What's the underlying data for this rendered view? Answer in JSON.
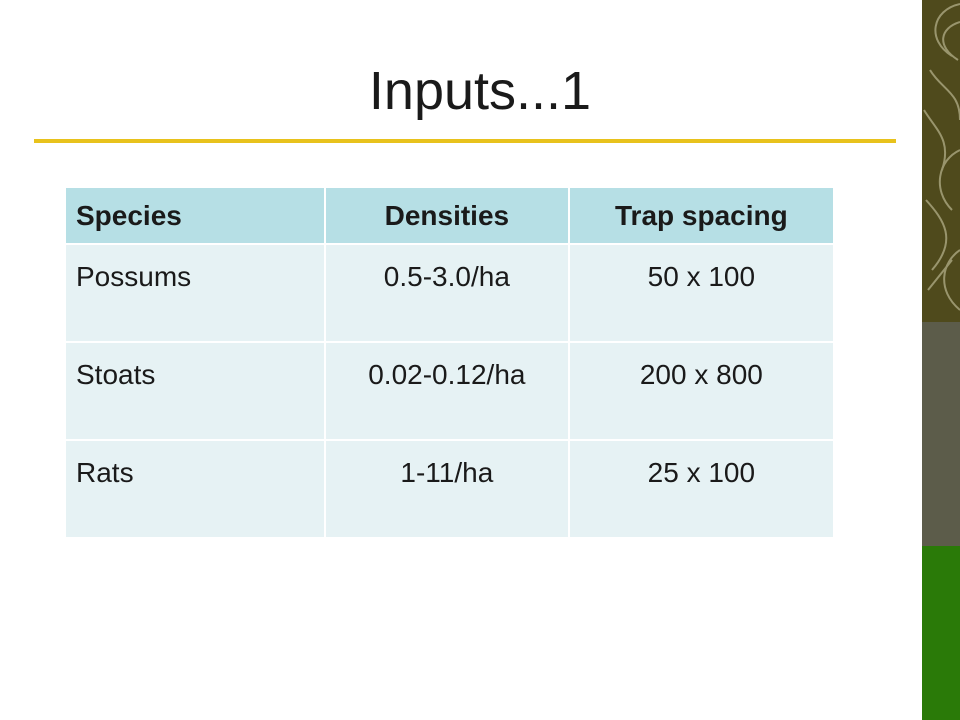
{
  "slide": {
    "title": "Inputs...1"
  },
  "table": {
    "headers": [
      "Species",
      "Densities",
      "Trap spacing"
    ],
    "rows": [
      [
        "Possums",
        "0.5-3.0/ha",
        "50 x 100"
      ],
      [
        "Stoats",
        "0.02-0.12/ha",
        "200 x 800"
      ],
      [
        "Rats",
        "1-11/ha",
        "25 x 100"
      ]
    ]
  },
  "colors": {
    "title_rule": "#e8c21c",
    "header_bg": "#b6dfe5",
    "cell_bg": "#e6f2f4",
    "sidebar_top": "#4f4a1c",
    "sidebar_mid": "#5c5c4a",
    "sidebar_bottom": "#2a7a08"
  }
}
